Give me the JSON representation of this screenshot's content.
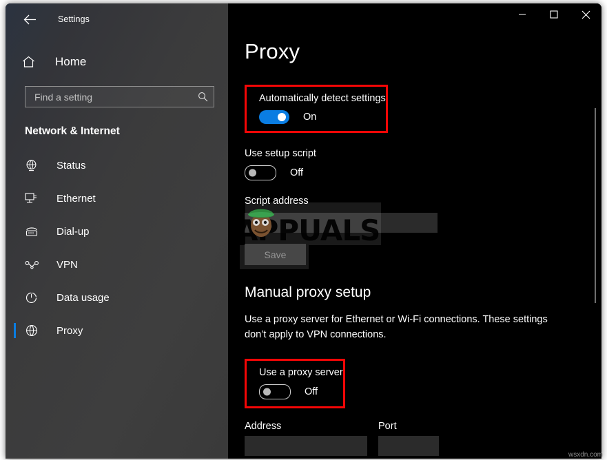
{
  "window": {
    "app_title": "Settings",
    "back_icon": "back-arrow-icon",
    "controls": {
      "minimize": "minimize-icon",
      "maximize": "maximize-icon",
      "close": "close-icon"
    }
  },
  "sidebar": {
    "home": {
      "label": "Home",
      "icon": "home-icon"
    },
    "search": {
      "value": "",
      "placeholder": "Find a setting",
      "icon": "search-icon"
    },
    "category": "Network & Internet",
    "items": [
      {
        "label": "Status",
        "icon": "status-globe-icon",
        "active": false
      },
      {
        "label": "Ethernet",
        "icon": "ethernet-icon",
        "active": false
      },
      {
        "label": "Dial-up",
        "icon": "dialup-icon",
        "active": false
      },
      {
        "label": "VPN",
        "icon": "vpn-icon",
        "active": false
      },
      {
        "label": "Data usage",
        "icon": "data-usage-icon",
        "active": false
      },
      {
        "label": "Proxy",
        "icon": "proxy-globe-icon",
        "active": true
      }
    ]
  },
  "main": {
    "title": "Proxy",
    "auto_detect": {
      "label": "Automatically detect settings",
      "state": "On",
      "highlighted": true
    },
    "setup_script": {
      "label": "Use setup script",
      "state": "Off"
    },
    "script_address": {
      "label": "Script address",
      "value": "",
      "placeholder": ""
    },
    "save_button": "Save",
    "manual": {
      "heading": "Manual proxy setup",
      "description": "Use a proxy server for Ethernet or Wi-Fi connections. These settings don’t apply to VPN connections.",
      "use_proxy": {
        "label": "Use a proxy server",
        "state": "Off",
        "highlighted": true
      },
      "address": {
        "label": "Address",
        "value": ""
      },
      "port": {
        "label": "Port",
        "value": ""
      }
    }
  },
  "watermark": {
    "text": "APPUALS",
    "corner": "wsxdn.com"
  },
  "colors": {
    "accent": "#0a7de2",
    "highlight": "#f40606",
    "panel_bg": "#000000"
  }
}
